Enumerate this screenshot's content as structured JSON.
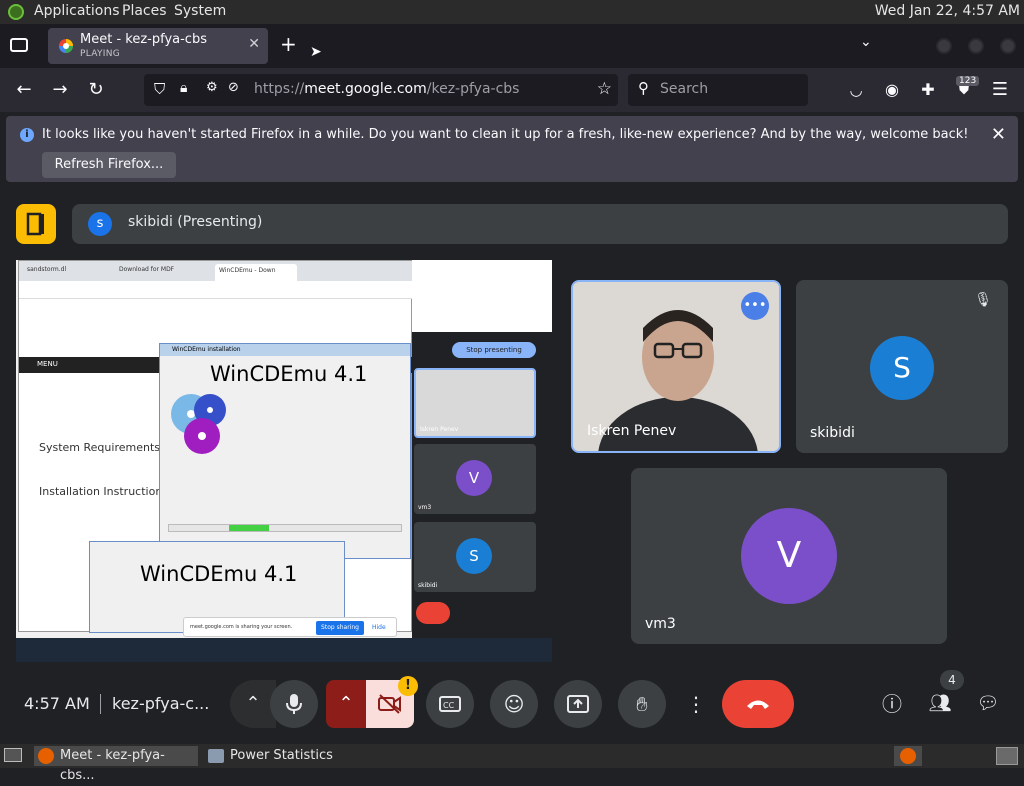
{
  "desktop": {
    "menus": [
      "Applications",
      "Places",
      "System"
    ],
    "clock": "Wed Jan 22,  4:57 AM"
  },
  "browser": {
    "tab": {
      "title": "Meet - kez-pfya-cbs",
      "subtitle": "PLAYING"
    },
    "url_prefix": "https://",
    "url_domain": "meet.google.com",
    "url_path": "/kez-pfya-cbs",
    "search_placeholder": "Search",
    "ext_badge": "123"
  },
  "notification": {
    "message": "It looks like you haven't started Firefox in a while. Do you want to clean it up for a fresh, like-new experience? And by the way, welcome back!",
    "button": "Refresh Firefox..."
  },
  "meet": {
    "presenting_avatar": "s",
    "presenting_label": "skibidi (Presenting)",
    "participants": [
      {
        "name": "Iskren Penev"
      },
      {
        "name": "skibidi",
        "initial": "S"
      },
      {
        "name": "vm3",
        "initial": "V"
      }
    ],
    "shared": {
      "window_title": "WinCDEmu 4.1",
      "dialog_title": "WinCDEmu installation",
      "window_title_2": "WinCDEmu 4.1",
      "stop_presenting": "Stop presenting",
      "stop_sharing": "Stop sharing",
      "hide": "Hide",
      "sharing_msg": "meet.google.com is sharing your screen.",
      "menu": "MENU",
      "sys_req": "System Requirements",
      "install": "Installation Instruction",
      "tab1": "sandstorm.dl",
      "tab2": "Download for MDF",
      "tab3": "WinCDEmu - Down",
      "inner_name": "Iskren Penev",
      "inner_vm3": "vm3",
      "inner_skibidi": "skibidi"
    },
    "controls": {
      "time": "4:57 AM",
      "meeting_code": "kez-pfya-c...",
      "people_count": "4",
      "alert": "!"
    }
  },
  "taskbar": {
    "items": [
      "Meet - kez-pfya-cbs...",
      "Power Statistics"
    ]
  },
  "colors": {
    "accent_blue": "#1a73e8",
    "end_call_red": "#ea4335",
    "presenter_yellow": "#fbbc04",
    "avatar_purple": "#7b4fc9",
    "avatar_blue": "#1a7fd4"
  }
}
